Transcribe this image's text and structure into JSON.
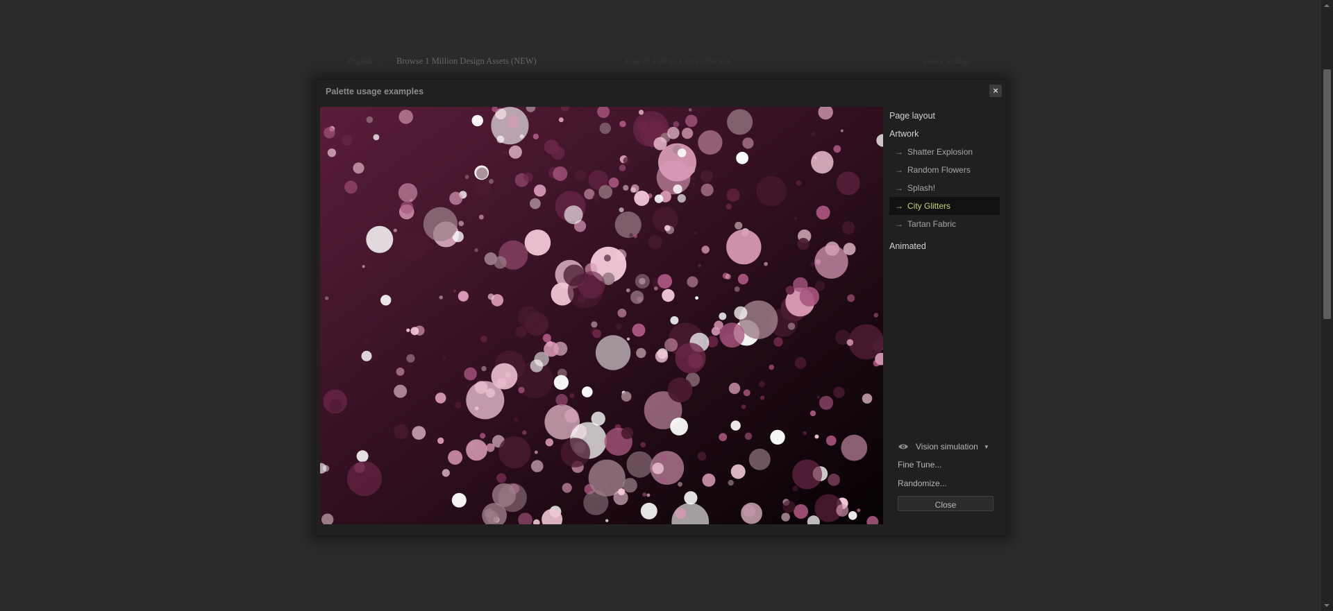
{
  "background_page": {
    "language": "English",
    "separator": "|",
    "browse_link": "Browse 1 Million Design Assets (NEW)",
    "like_text": "Like it? Fabrics Live Collection",
    "version_text": "yeeux settings"
  },
  "dialog": {
    "title": "Palette usage examples",
    "close_icon": "×",
    "sidebar": {
      "page_layout": "Page layout",
      "artwork": "Artwork",
      "items": [
        {
          "label": "Shatter Explosion",
          "active": false
        },
        {
          "label": "Random Flowers",
          "active": false
        },
        {
          "label": "Splash!",
          "active": false
        },
        {
          "label": "City Glitters",
          "active": true
        },
        {
          "label": "Tartan Fabric",
          "active": false
        }
      ],
      "animated": "Animated",
      "arrow": "→"
    },
    "vision_simulation": "Vision simulation",
    "vision_caret": "▼",
    "fine_tune": "Fine Tune...",
    "randomize": "Randomize...",
    "close_button": "Close"
  },
  "colors": {
    "palette": [
      "#ffffff",
      "#f2c6d7",
      "#d99ab6",
      "#a8557e",
      "#6b2748",
      "#9d7f8a",
      "#4a1a30"
    ],
    "art_gradient_start": "#5a1d3a",
    "art_gradient_end": "#050103",
    "active_item_text": "#c8d27a"
  },
  "icons": {
    "eye": "eye-icon",
    "close": "close-icon",
    "caret": "caret-down-icon"
  }
}
